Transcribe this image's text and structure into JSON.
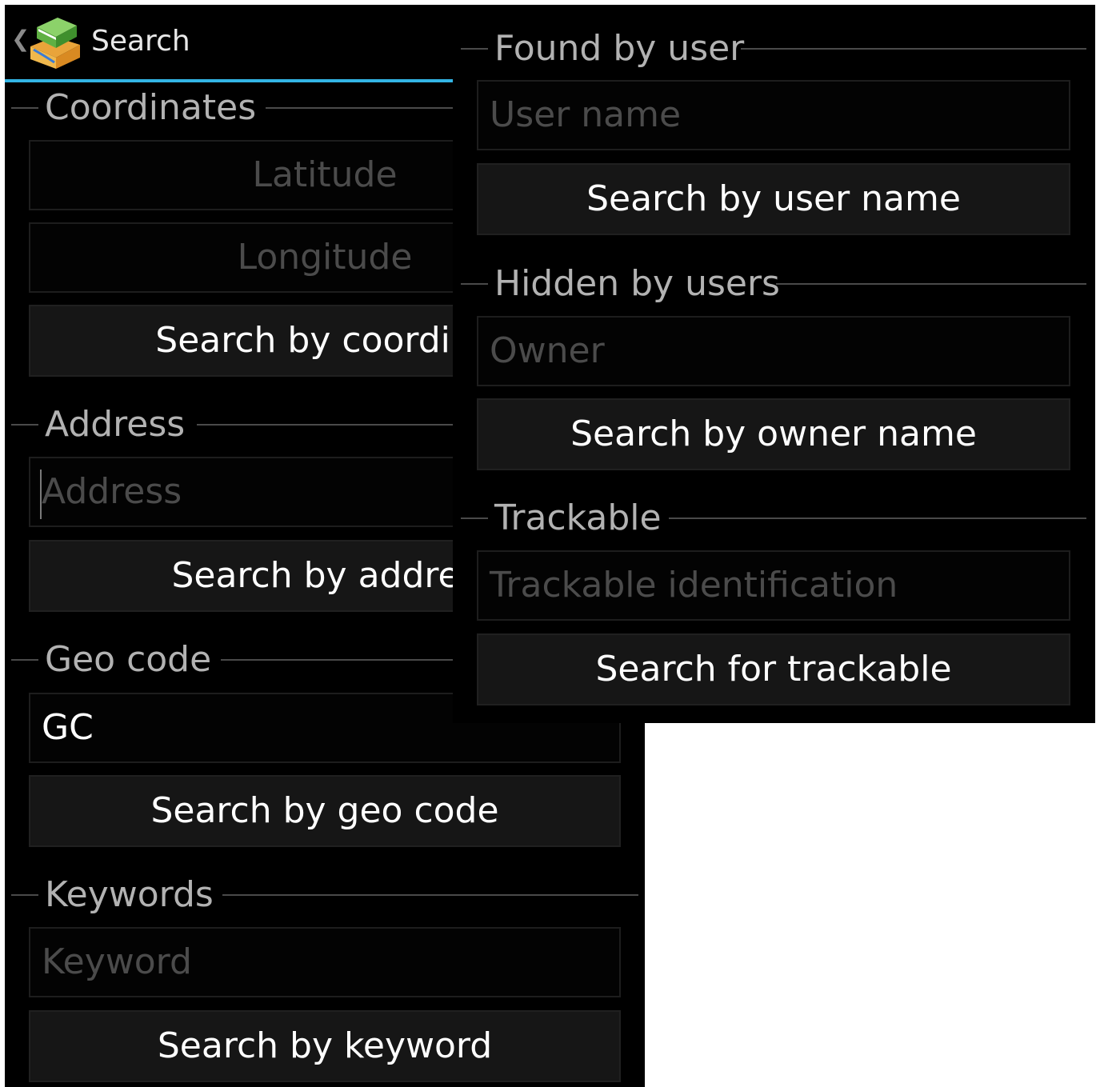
{
  "action_bar": {
    "title": "Search"
  },
  "coordinates": {
    "header": "Coordinates",
    "latitude_placeholder": "Latitude",
    "longitude_placeholder": "Longitude",
    "button": "Search by coordina"
  },
  "address": {
    "header": "Address",
    "placeholder": "Address",
    "button": "Search by addres"
  },
  "geocode": {
    "header": "Geo code",
    "value": "GC",
    "button": "Search by geo code"
  },
  "keywords": {
    "header": "Keywords",
    "placeholder": "Keyword",
    "button": "Search by keyword"
  },
  "found_by_user": {
    "header": "Found by user",
    "placeholder": "User name",
    "button": "Search by user name"
  },
  "hidden_by_users": {
    "header": "Hidden by users",
    "placeholder": "Owner",
    "button": "Search by owner name"
  },
  "trackable": {
    "header": "Trackable",
    "placeholder": "Trackable identification",
    "button": "Search for trackable"
  },
  "colors": {
    "accent": "#33b5e5",
    "background": "#000000",
    "button": "#161616"
  },
  "icons": {
    "app": "app-logo-icon",
    "up": "back-caret-icon"
  }
}
